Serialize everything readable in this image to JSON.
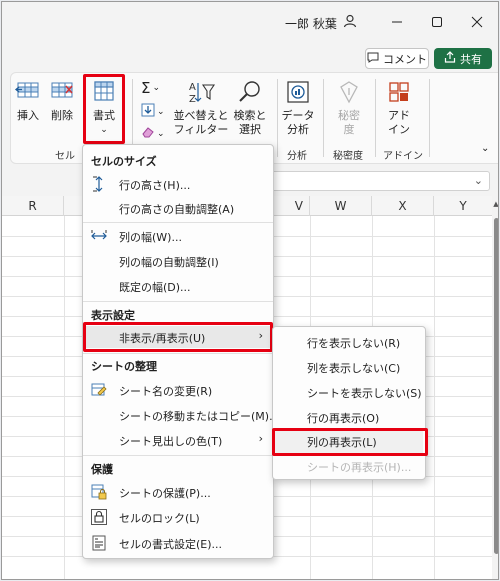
{
  "titlebar": {
    "user_name": "一郎 秋葉",
    "buttons": [
      "minimize-icon",
      "maximize-icon",
      "close-icon"
    ]
  },
  "commands": {
    "comment_label": "コメント",
    "share_label": "共有"
  },
  "ribbon": {
    "insert_label": "挿入",
    "delete_label": "削除",
    "format_label": "書式",
    "sort_label_1": "並べ替えと",
    "sort_label_2": "フィルター",
    "find_label_1": "検索と",
    "find_label_2": "選択",
    "analyze_label_1": "データ",
    "analyze_label_2": "分析",
    "sensitivity_label_1": "秘密",
    "sensitivity_label_2": "度",
    "addin_label_1": "アド",
    "addin_label_2": "イン",
    "group_cells": "セル",
    "group_analyze": "分析",
    "group_sensitivity": "秘密度",
    "group_addin": "アドイン",
    "accent_color": "#e60012",
    "brand_color": "#1e7145"
  },
  "sheet": {
    "columns": [
      "R",
      "V",
      "W",
      "X",
      "Y"
    ]
  },
  "menu": {
    "heading_cell_size": "セルのサイズ",
    "row_height": "行の高さ(H)...",
    "autofit_row": "行の高さの自動調整(A)",
    "column_width": "列の幅(W)...",
    "autofit_column": "列の幅の自動調整(I)",
    "default_width": "既定の幅(D)...",
    "heading_visibility": "表示設定",
    "hide_unhide": "非表示/再表示(U)",
    "heading_organize": "シートの整理",
    "rename_sheet": "シート名の変更(R)",
    "move_copy": "シートの移動またはコピー(M)...",
    "tab_color": "シート見出しの色(T)",
    "heading_protection": "保護",
    "protect_sheet": "シートの保護(P)...",
    "lock_cell": "セルのロック(L)",
    "format_cells": "セルの書式設定(E)..."
  },
  "submenu": {
    "hide_rows": "行を表示しない(R)",
    "hide_columns": "列を表示しない(C)",
    "hide_sheet": "シートを表示しない(S)",
    "unhide_rows": "行の再表示(O)",
    "unhide_columns": "列の再表示(L)",
    "unhide_sheet": "シートの再表示(H)..."
  }
}
